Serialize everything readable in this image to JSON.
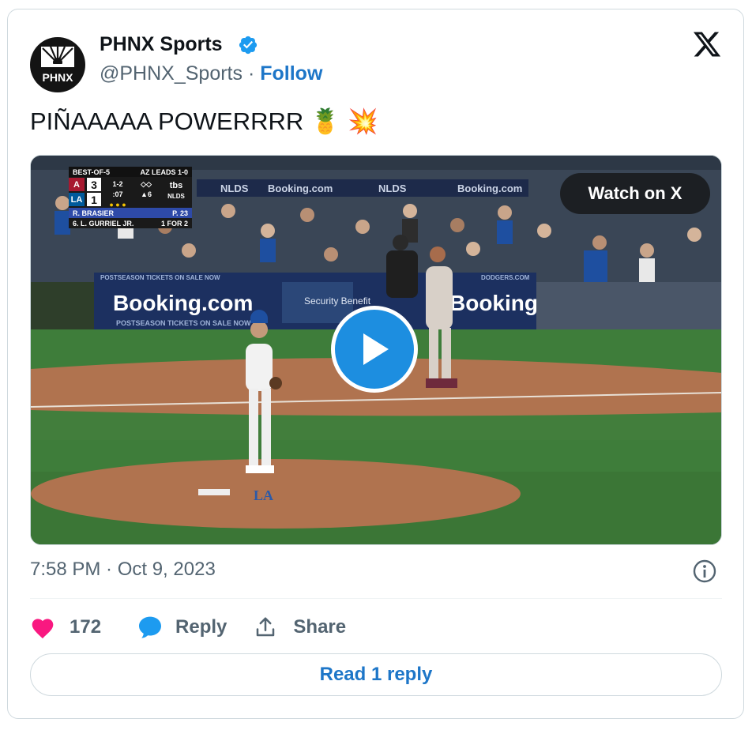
{
  "author": {
    "name": "PHNX Sports",
    "handle": "@PHNX_Sports",
    "separator": "·",
    "follow_label": "Follow",
    "avatar_text": "PHNX"
  },
  "tweet": {
    "text": "PIÑAAAAA POWERRRR 🍍 💥"
  },
  "media": {
    "watch_label": "Watch on X",
    "scorebug": {
      "series": "BEST-OF-5",
      "series_status": "AZ LEADS 1-0",
      "away_score": "3",
      "home_score": "1",
      "count": "1-2",
      "outs_time": ":07",
      "outs_dots": "● ● ●",
      "inning": "▲6",
      "network": "tbs",
      "network_sub": "NLDS",
      "pitcher": "R. BRASIER",
      "pitch_count": "P. 23",
      "batter": "6. L. GURRIEL JR.",
      "batter_stat": "1 FOR 2"
    },
    "signage": {
      "banner_top_1": "NLDS",
      "banner_top_2": "Booking.com",
      "banner_top_3": "NLDS",
      "banner_top_4": "Booking.com",
      "wall_ad": "Booking.com",
      "wall_ad_sub": "POSTSEASON TICKETS ON SALE NOW",
      "wall_ad_top": "POSTSEASON TICKETS ON SALE NOW",
      "sponsor": "Security Benefit",
      "wall_ad_2": "Booking.com",
      "dodgers_url": "DODGERS.COM",
      "mound_logo": "LA"
    }
  },
  "footer": {
    "timestamp": "7:58 PM · Oct 9, 2023",
    "like_count": "172",
    "reply_label": "Reply",
    "share_label": "Share",
    "read_replies_label": "Read 1 reply"
  },
  "colors": {
    "accent_blue": "#1d76c8",
    "verified_blue": "#1d9bf0",
    "heart_pink": "#f91880",
    "secondary_text": "#536471"
  }
}
